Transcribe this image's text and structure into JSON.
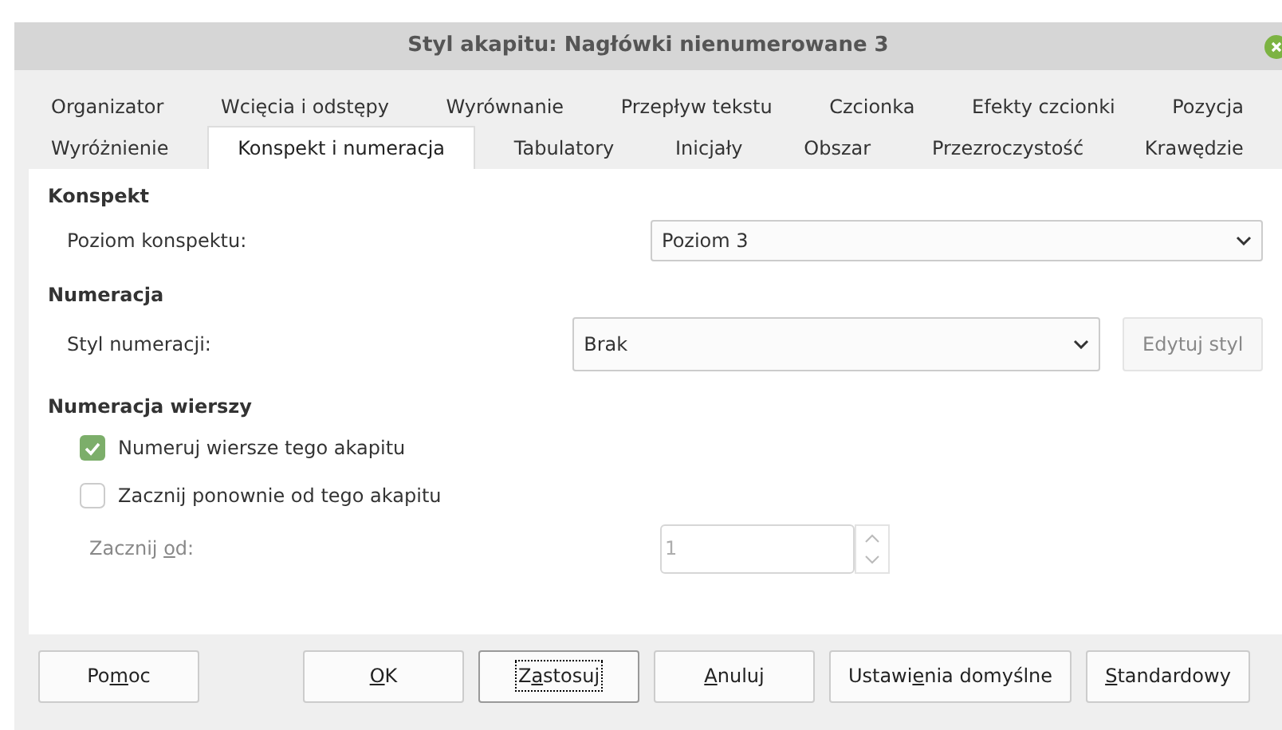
{
  "window": {
    "title": "Styl akapitu: Nagłówki nienumerowane 3"
  },
  "tab_rows": [
    [
      {
        "label": "Organizator",
        "selected": false
      },
      {
        "label": "Wcięcia i odstępy",
        "selected": false
      },
      {
        "label": "Wyrównanie",
        "selected": false
      },
      {
        "label": "Przepływ tekstu",
        "selected": false
      },
      {
        "label": "Czcionka",
        "selected": false
      },
      {
        "label": "Efekty czcionki",
        "selected": false
      },
      {
        "label": "Pozycja",
        "selected": false
      }
    ],
    [
      {
        "label": "Wyróżnienie",
        "selected": false
      },
      {
        "label": "Konspekt i numeracja",
        "selected": true
      },
      {
        "label": "Tabulatory",
        "selected": false
      },
      {
        "label": "Inicjały",
        "selected": false
      },
      {
        "label": "Obszar",
        "selected": false
      },
      {
        "label": "Przezroczystość",
        "selected": false
      },
      {
        "label": "Krawędzie",
        "selected": false
      }
    ]
  ],
  "outline": {
    "heading": "Konspekt",
    "level_label": "Poziom konspektu:",
    "level_value": "Poziom 3"
  },
  "numbering": {
    "heading": "Numeracja",
    "style_label": "Styl numeracji:",
    "style_value": "Brak",
    "edit_button": {
      "label": "Edytuj styl",
      "disabled": true
    }
  },
  "line_numbering": {
    "heading": "Numeracja wierszy",
    "checkboxes": [
      {
        "label": "Numeruj wiersze tego akapitu",
        "checked": true
      },
      {
        "label": "Zacznij ponownie od tego akapitu",
        "checked": false
      }
    ],
    "start_label": {
      "before": "Zacznij ",
      "key": "o",
      "after": "d:"
    },
    "start_value": "1",
    "start_disabled": true
  },
  "buttons": [
    {
      "label": {
        "before": "Po",
        "key": "m",
        "after": "oc"
      },
      "focused": false
    },
    {
      "label": {
        "key": "O",
        "after": "K"
      },
      "focused": false
    },
    {
      "label": {
        "before": "Z",
        "key": "a",
        "after": "stosuj"
      },
      "focused": true
    },
    {
      "label": {
        "key": "A",
        "after": "nuluj"
      },
      "focused": false
    },
    {
      "label": {
        "before": "Ustawi",
        "key": "e",
        "after": "nia domyślne"
      },
      "focused": false
    },
    {
      "label": {
        "key": "S",
        "after": "tandardowy"
      },
      "focused": false
    }
  ]
}
